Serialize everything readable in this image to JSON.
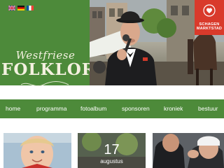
{
  "header": {
    "brand_script": "Westfriese",
    "brand_main": "FOLKLORE",
    "languages": [
      "english-flag",
      "german-flag",
      "french-flag"
    ],
    "badge": {
      "line1": "SCHAGEN",
      "line2": "MARKTSTAD",
      "icon": "heart-icon"
    },
    "colors": {
      "brand_green": "#4d8a3a",
      "badge_red": "#d93a2b"
    }
  },
  "nav": {
    "items": [
      "home",
      "programma",
      "fotoalbum",
      "sponsoren",
      "kroniek",
      "bestuur"
    ]
  },
  "cards": {
    "event": {
      "day": "17",
      "month": "augustus"
    }
  }
}
